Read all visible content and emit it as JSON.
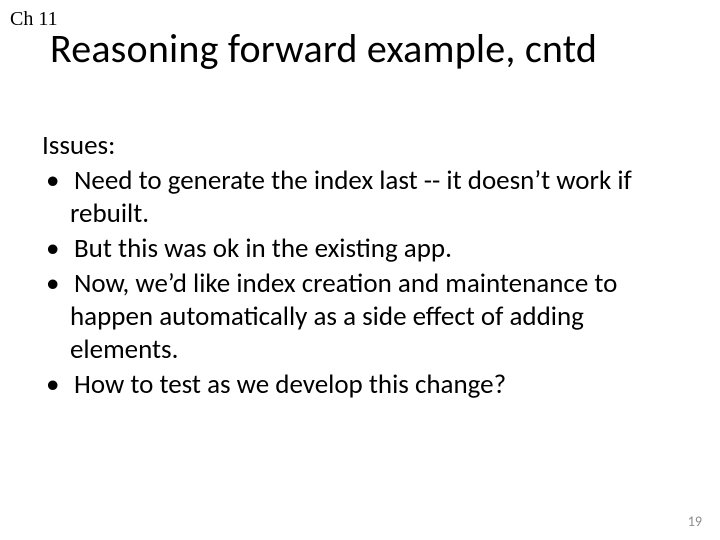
{
  "chapter": "Ch 11",
  "title": "Reasoning forward example, cntd",
  "issues_label": "Issues:",
  "bullets": [
    "Need to generate the index last -- it doesn’t work if rebuilt.",
    "But this was ok in the existing app.",
    "Now, we’d like index creation and maintenance to happen automatically as a side effect of adding elements.",
    "How to test as we develop this change?"
  ],
  "page_number": "19"
}
